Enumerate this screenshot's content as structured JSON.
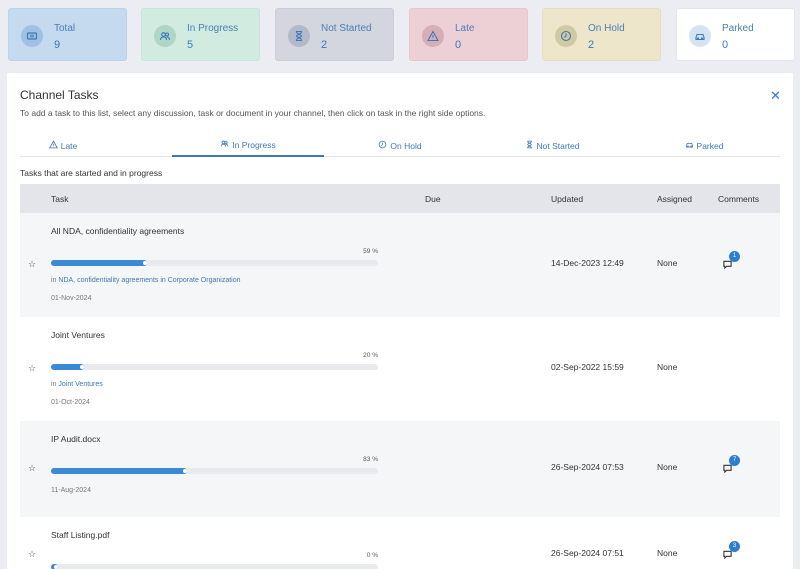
{
  "summary": [
    {
      "label": "Total",
      "count": "9",
      "icon": "ticket-icon",
      "bg": "#c5d9ef",
      "border": "#bcd3ec",
      "iconbg": "#9fc1e4"
    },
    {
      "label": "In Progress",
      "count": "5",
      "icon": "users-icon",
      "bg": "#d2ebe0",
      "border": "#c8e6d9",
      "iconbg": "#aed5c7"
    },
    {
      "label": "Not Started",
      "count": "2",
      "icon": "hourglass-icon",
      "bg": "#d3d5df",
      "border": "#cbcdd8",
      "iconbg": "#b4b9c9"
    },
    {
      "label": "Late",
      "count": "0",
      "icon": "warning-icon",
      "bg": "#ecd0d6",
      "border": "#e6c7ce",
      "iconbg": "#d7adb7"
    },
    {
      "label": "On Hold",
      "count": "2",
      "icon": "clock-icon",
      "bg": "#ede6cb",
      "border": "#e6dec1",
      "iconbg": "#d1c9a4"
    },
    {
      "label": "Parked",
      "count": "0",
      "icon": "car-icon",
      "bg": "#ffffff",
      "border": "#e3e6ea",
      "iconbg": "#d5e4f3"
    }
  ],
  "panel": {
    "title": "Channel Tasks",
    "close": "✕",
    "hint": "To add a task to this list, select any discussion, task or document in your channel, then click on task in the right side options.",
    "subtitle": "Tasks that are started and in progress"
  },
  "tabs": [
    {
      "label": "Late",
      "icon": "warning-icon"
    },
    {
      "label": "In Progress",
      "icon": "users-icon",
      "active": true
    },
    {
      "label": "On Hold",
      "icon": "clock-icon"
    },
    {
      "label": "Not Started",
      "icon": "hourglass-icon"
    },
    {
      "label": "Parked",
      "icon": "car-icon"
    }
  ],
  "columns": {
    "task": "Task",
    "due": "Due",
    "updated": "Updated",
    "assigned": "Assigned",
    "comments": "Comments"
  },
  "rows": [
    {
      "name": "All NDA, confidentiality agreements",
      "progress": 59,
      "progress_label": "59 %",
      "loc_prefix": "in ",
      "loc": "NDA, confidentiality agreements in Corporate Organization",
      "date": "01-Nov-2024",
      "updated": "14-Dec-2023 12:49",
      "assigned": "None",
      "comments": "1"
    },
    {
      "name": "Joint Ventures",
      "progress": 20,
      "progress_label": "20 %",
      "loc_prefix": "in ",
      "loc": "Joint Ventures",
      "date": "01-Oct-2024",
      "updated": "02-Sep-2022 15:59",
      "assigned": "None",
      "comments": ""
    },
    {
      "name": "IP Audit.docx",
      "progress": 83,
      "progress_label": "83 %",
      "loc_prefix": "",
      "loc": "",
      "date": "11-Aug-2024",
      "updated": "26-Sep-2024 07:53",
      "assigned": "None",
      "comments": "7"
    },
    {
      "name": "Staff Listing.pdf",
      "progress": 0,
      "progress_label": "0 %",
      "loc_prefix": "",
      "loc": "",
      "date": "",
      "updated": "26-Sep-2024 07:51",
      "assigned": "None",
      "comments": "3"
    }
  ]
}
